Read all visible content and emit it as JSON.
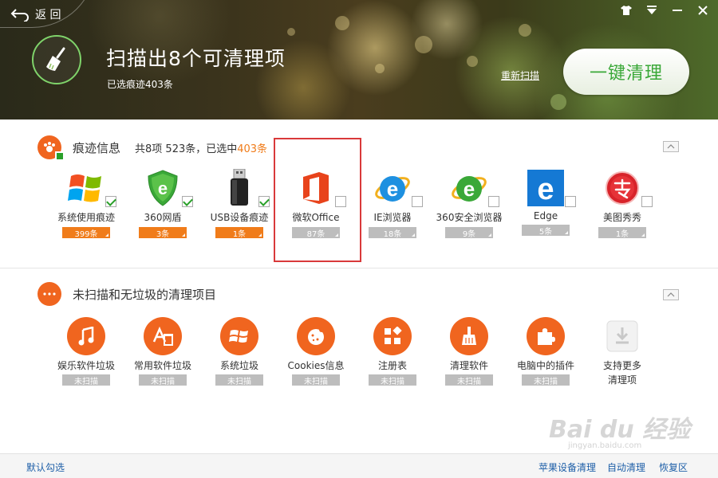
{
  "header": {
    "back_label": "返 回",
    "scan_title": "扫描出8个可清理项",
    "scan_subtitle": "已选痕迹403条",
    "rescan_label": "重新扫描",
    "clean_button_label": "一键清理"
  },
  "traces": {
    "title": "痕迹信息",
    "summary_prefix": "共8项 523条，已选中",
    "summary_selected": "403条",
    "items": [
      {
        "label": "系统使用痕迹",
        "count": "399条",
        "checked": true,
        "icon": "windows-logo-icon"
      },
      {
        "label": "360网盾",
        "count": "3条",
        "checked": true,
        "icon": "360-shield-icon"
      },
      {
        "label": "USB设备痕迹",
        "count": "1条",
        "checked": true,
        "icon": "usb-drive-icon"
      },
      {
        "label": "微软Office",
        "count": "87条",
        "checked": false,
        "icon": "office-logo-icon"
      },
      {
        "label": "IE浏览器",
        "count": "18条",
        "checked": false,
        "icon": "ie-logo-icon"
      },
      {
        "label": "360安全浏览器",
        "count": "9条",
        "checked": false,
        "icon": "360-browser-icon"
      },
      {
        "label": "Edge",
        "count": "5条",
        "checked": false,
        "icon": "edge-logo-icon"
      },
      {
        "label": "美图秀秀",
        "count": "1条",
        "checked": false,
        "icon": "meitu-logo-icon"
      }
    ]
  },
  "unscanned": {
    "title": "未扫描和无垃圾的清理项目",
    "items": [
      {
        "label": "娱乐软件垃圾",
        "status": "未扫描",
        "icon": "music-note-icon"
      },
      {
        "label": "常用软件垃圾",
        "status": "未扫描",
        "icon": "app-trash-icon"
      },
      {
        "label": "系统垃圾",
        "status": "未扫描",
        "icon": "windows-logo-icon"
      },
      {
        "label": "Cookies信息",
        "status": "未扫描",
        "icon": "cookie-icon"
      },
      {
        "label": "注册表",
        "status": "未扫描",
        "icon": "registry-blocks-icon"
      },
      {
        "label": "清理软件",
        "status": "未扫描",
        "icon": "broom-icon"
      },
      {
        "label": "电脑中的插件",
        "status": "未扫描",
        "icon": "puzzle-piece-icon"
      }
    ],
    "more_label_line1": "支持更多",
    "more_label_line2": "清理项"
  },
  "footer": {
    "default_select": "默认勾选",
    "apple_clean": "苹果设备清理",
    "auto_clean": "自动清理",
    "restore": "恢复区"
  },
  "watermark": {
    "main": "Bai du 经验",
    "url": "jingyan.baidu.com"
  },
  "colors": {
    "accent_orange": "#f0651f",
    "badge_orange": "#f07c1a",
    "green": "#3aa838",
    "link_blue": "#1e5fa8",
    "highlight_red": "#d9393a"
  }
}
